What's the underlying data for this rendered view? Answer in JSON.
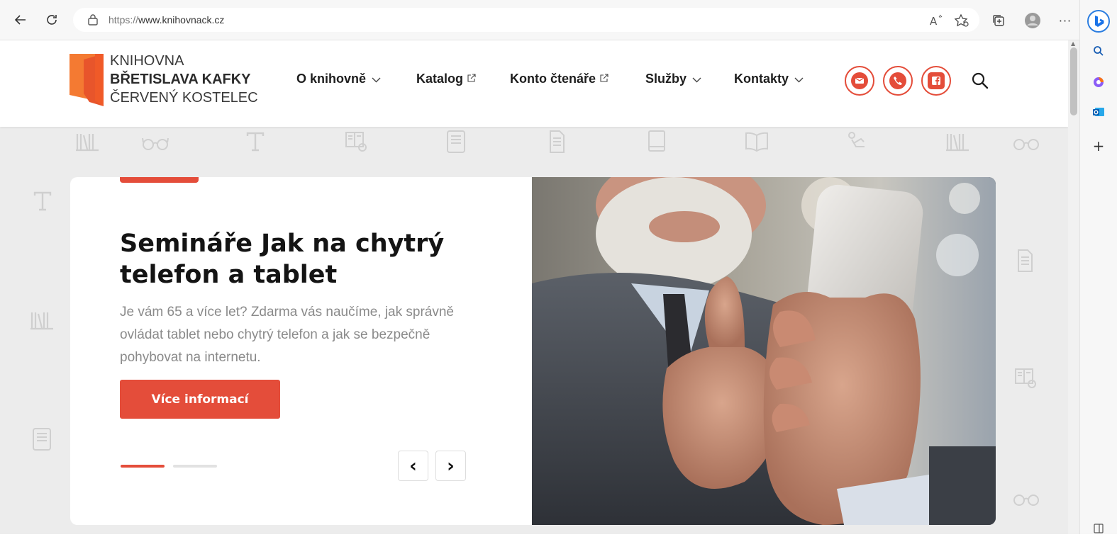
{
  "browser": {
    "url_proto": "https://",
    "url_host": "www.knihovnack.cz"
  },
  "site": {
    "logo": {
      "line1": "KNIHOVNA",
      "line2": "BŘETISLAVA KAFKY",
      "line3": "ČERVENÝ KOSTELEC"
    },
    "nav": [
      {
        "label": "O knihovně",
        "kind": "dropdown"
      },
      {
        "label": "Katalog",
        "kind": "external"
      },
      {
        "label": "Konto čtenáře",
        "kind": "external"
      },
      {
        "label": "Služby",
        "kind": "dropdown"
      },
      {
        "label": "Kontakty",
        "kind": "dropdown"
      }
    ],
    "contact_icons": [
      "email-icon",
      "phone-icon",
      "facebook-icon"
    ],
    "accent_color": "#e44d3a"
  },
  "hero": {
    "title": "Semináře Jak na chytrý telefon a tablet",
    "description": "Je vám 65 a více let? Zdarma vás naučíme, jak správně ovládat tablet nebo chytrý telefon a jak se bezpečně pohybovat na internetu.",
    "button": "Více informací",
    "slides_total": 2,
    "slide_active": 1,
    "prev_icon": "‹",
    "next_icon": "›"
  }
}
